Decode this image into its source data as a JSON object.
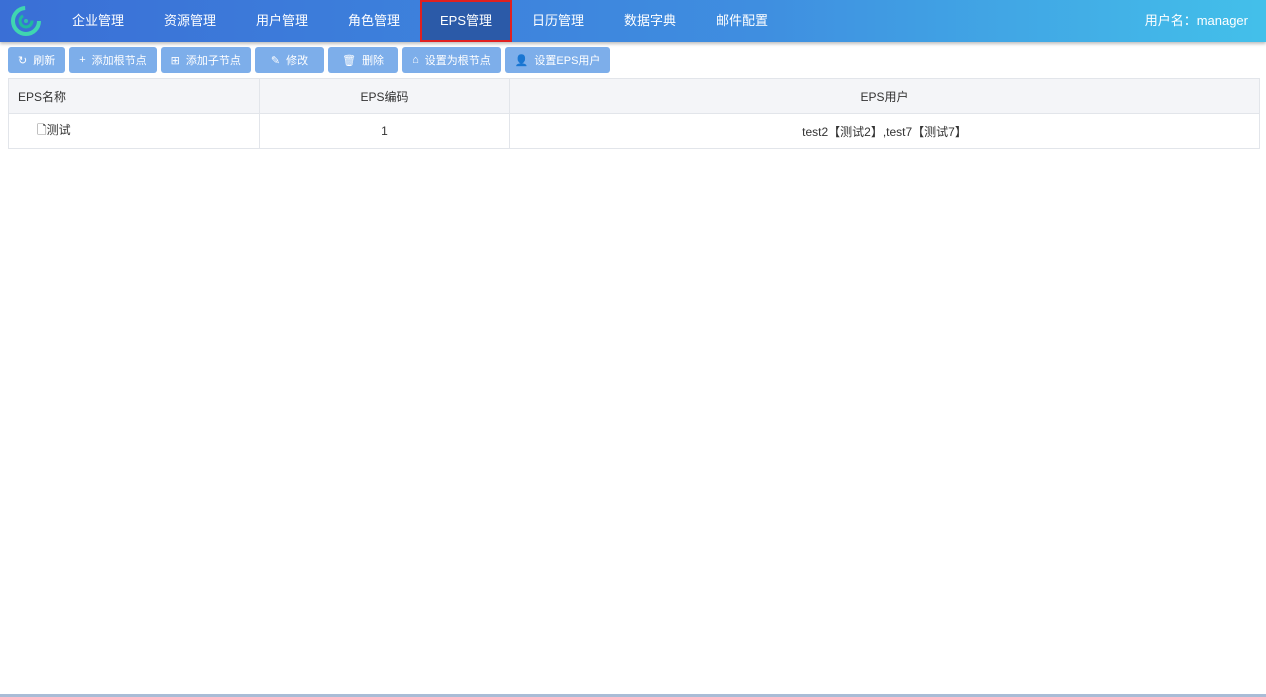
{
  "nav": {
    "items": [
      "企业管理",
      "资源管理",
      "用户管理",
      "角色管理",
      "EPS管理",
      "日历管理",
      "数据字典",
      "邮件配置"
    ],
    "active": 4,
    "user": "用户名：manager"
  },
  "toolbar": {
    "refresh": "刷新",
    "add_root": "添加根节点",
    "add_child": "添加子节点",
    "edit": "修改",
    "delete": "删除",
    "set_root": "设置为根节点",
    "set_user": "设置EPS用户"
  },
  "table": {
    "headers": [
      "EPS名称",
      "EPS编码",
      "EPS用户"
    ],
    "rows": [
      {
        "name": "测试",
        "code": "1",
        "users": "test2【测试2】,test7【测试7】"
      }
    ]
  }
}
